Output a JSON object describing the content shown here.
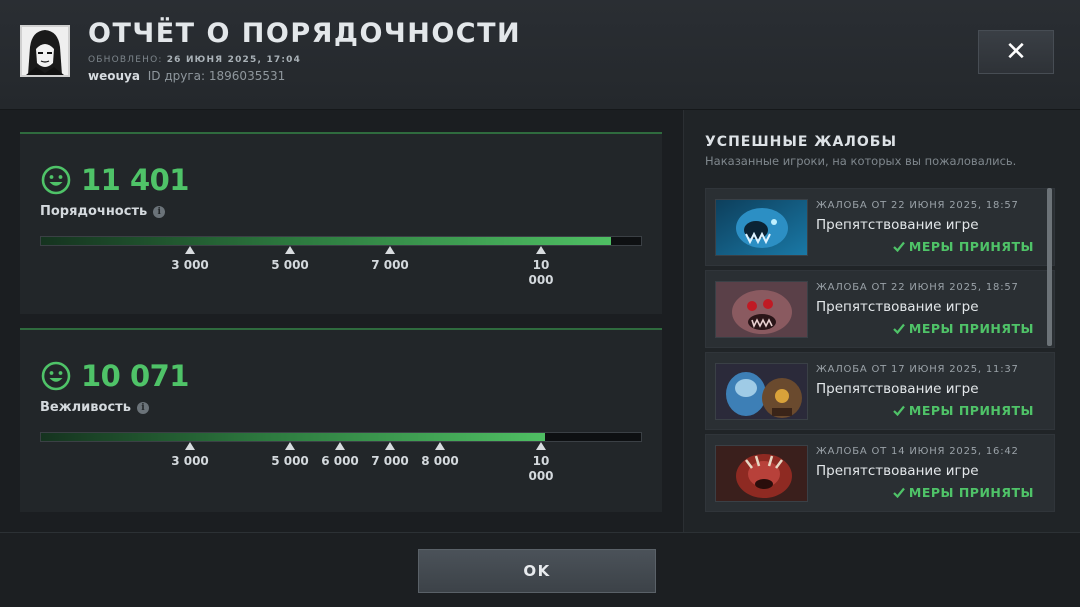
{
  "header": {
    "title": "ОТЧЁТ О ПОРЯДОЧНОСТИ",
    "updated_label": "ОБНОВЛЕНО:",
    "updated_value": "26 ИЮНЯ 2025, 17:04",
    "username": "weouya",
    "friend_id": "ID друга: 1896035531",
    "close_label": "✕"
  },
  "metrics": [
    {
      "score": "11 401",
      "label": "Порядочность",
      "fill_value": 11401,
      "range_max": 12000,
      "ticks": [
        "3 000",
        "5 000",
        "7 000",
        "10 000"
      ]
    },
    {
      "score": "10 071",
      "label": "Вежливость",
      "fill_value": 10071,
      "range_max": 12000,
      "ticks": [
        "3 000",
        "5 000",
        "6 000",
        "7 000",
        "8 000",
        "10 000"
      ]
    }
  ],
  "reports": {
    "title": "УСПЕШНЫЕ ЖАЛОБЫ",
    "subtitle": "Наказанные игроки, на которых вы пожаловались.",
    "items": [
      {
        "date": "ЖАЛОБА ОТ 22 ИЮНЯ 2025, 18:57",
        "reason": "Препятствование игре",
        "status": "МЕРЫ ПРИНЯТЫ"
      },
      {
        "date": "ЖАЛОБА ОТ 22 ИЮНЯ 2025, 18:57",
        "reason": "Препятствование игре",
        "status": "МЕРЫ ПРИНЯТЫ"
      },
      {
        "date": "ЖАЛОБА ОТ 17 ИЮНЯ 2025, 11:37",
        "reason": "Препятствование игре",
        "status": "МЕРЫ ПРИНЯТЫ"
      },
      {
        "date": "ЖАЛОБА ОТ 14 ИЮНЯ 2025, 16:42",
        "reason": "Препятствование игре",
        "status": "МЕРЫ ПРИНЯТЫ"
      }
    ]
  },
  "footer": {
    "ok_label": "OK"
  },
  "colors": {
    "accent_green": "#4fc368",
    "background": "#1b1e21"
  }
}
